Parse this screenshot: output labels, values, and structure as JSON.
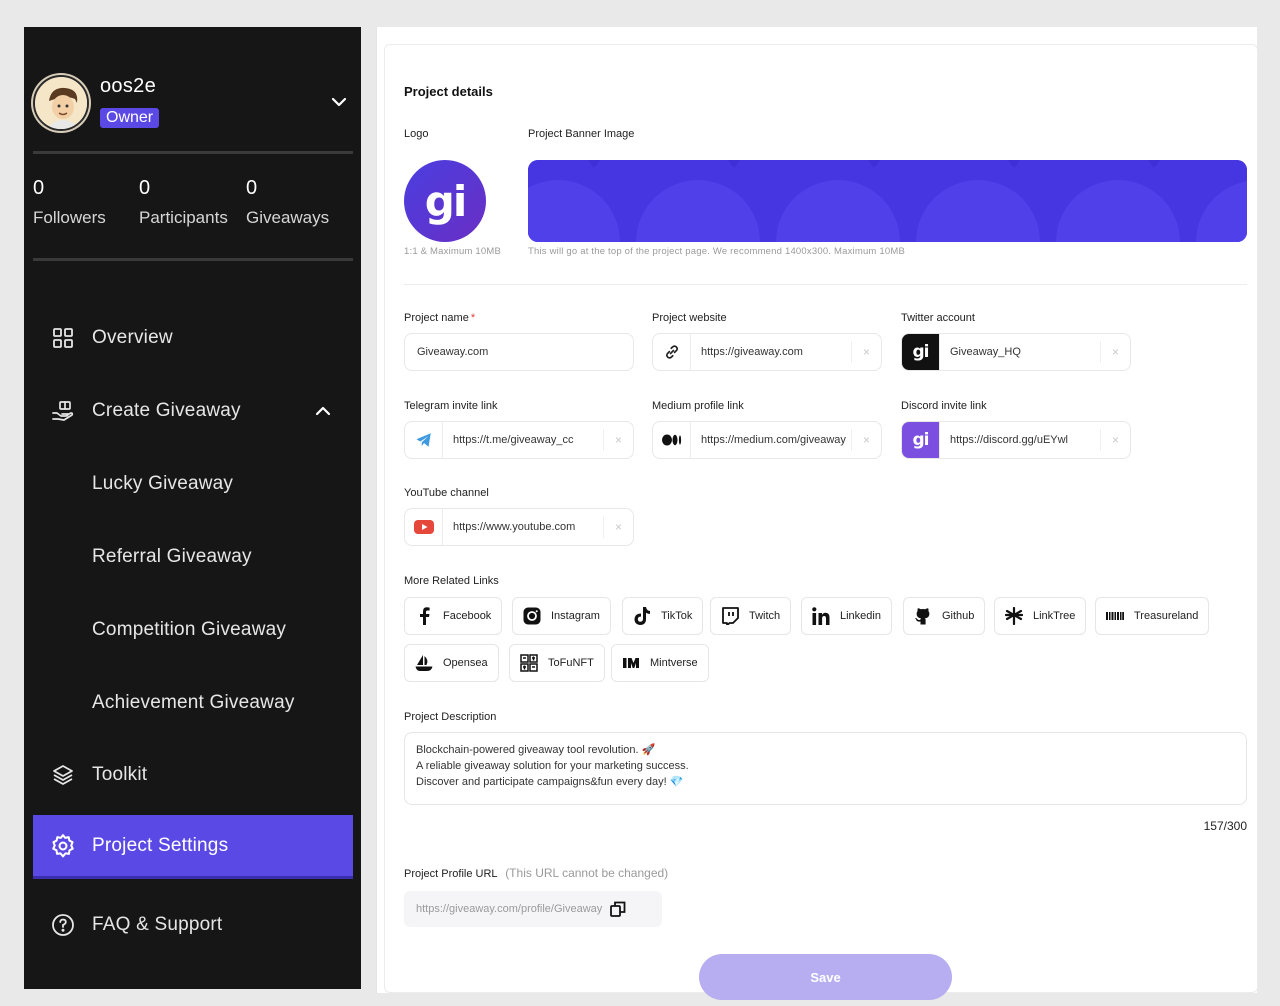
{
  "sidebar": {
    "profile": {
      "username": "oos2e",
      "role": "Owner"
    },
    "stats": [
      {
        "value": "0",
        "label": "Followers"
      },
      {
        "value": "0",
        "label": "Participants"
      },
      {
        "value": "0",
        "label": "Giveaways"
      }
    ],
    "nav": {
      "overview": "Overview",
      "create_giveaway": "Create Giveaway",
      "lucky": "Lucky Giveaway",
      "referral": "Referral Giveaway",
      "competition": "Competition Giveaway",
      "achievement": "Achievement Giveaway",
      "toolkit": "Toolkit",
      "project_settings": "Project Settings",
      "faq": "FAQ & Support"
    },
    "accent": "#5b49e6"
  },
  "form": {
    "title": "Project details",
    "logo": {
      "label": "Logo",
      "hint": "1:1 & Maximum 10MB",
      "text": "gi"
    },
    "banner": {
      "label": "Project Banner Image",
      "hint": "This will go at the top of the project page. We recommend 1400x300. Maximum 10MB"
    },
    "project_name": {
      "label": "Project name",
      "required": "*",
      "value": "Giveaway.com"
    },
    "project_website": {
      "label": "Project website",
      "value": "https://giveaway.com",
      "icon": "link-icon"
    },
    "twitter": {
      "label": "Twitter account",
      "value": "Giveaway_HQ",
      "icon": "gi-logo-icon"
    },
    "telegram": {
      "label": "Telegram invite link",
      "value": "https://t.me/giveaway_cc",
      "icon": "telegram-icon"
    },
    "medium": {
      "label": "Medium profile link",
      "value": "https://medium.com/giveaway",
      "icon": "medium-icon"
    },
    "discord": {
      "label": "Discord invite link",
      "value": "https://discord.gg/uEYwl",
      "icon": "gi-logo-icon"
    },
    "youtube": {
      "label": "YouTube channel",
      "value": "https://www.youtube.com",
      "icon": "youtube-icon"
    },
    "clear_symbol": "×",
    "more_links": {
      "label": "More Related Links",
      "items": [
        {
          "label": "Facebook",
          "icon": "facebook-icon"
        },
        {
          "label": "Instagram",
          "icon": "instagram-icon"
        },
        {
          "label": "TikTok",
          "icon": "tiktok-icon"
        },
        {
          "label": "Twitch",
          "icon": "twitch-icon"
        },
        {
          "label": "Linkedin",
          "icon": "linkedin-icon"
        },
        {
          "label": "Github",
          "icon": "github-icon"
        },
        {
          "label": "LinkTree",
          "icon": "linktree-icon"
        },
        {
          "label": "Treasureland",
          "icon": "treasureland-icon"
        },
        {
          "label": "Opensea",
          "icon": "opensea-icon"
        },
        {
          "label": "ToFuNFT",
          "icon": "tofunft-icon"
        },
        {
          "label": "Mintverse",
          "icon": "mintverse-icon"
        }
      ]
    },
    "description": {
      "label": "Project Description",
      "lines": [
        "Blockchain-powered giveaway tool revolution. 🚀",
        "A reliable giveaway solution for your marketing success.",
        "Discover and participate campaigns&fun every day! 💎"
      ],
      "counter": "157/300"
    },
    "profile_url": {
      "label": "Project Profile URL",
      "note": "(This URL cannot be changed)",
      "value": "https://giveaway.com/profile/Giveaway"
    },
    "save_label": "Save"
  }
}
